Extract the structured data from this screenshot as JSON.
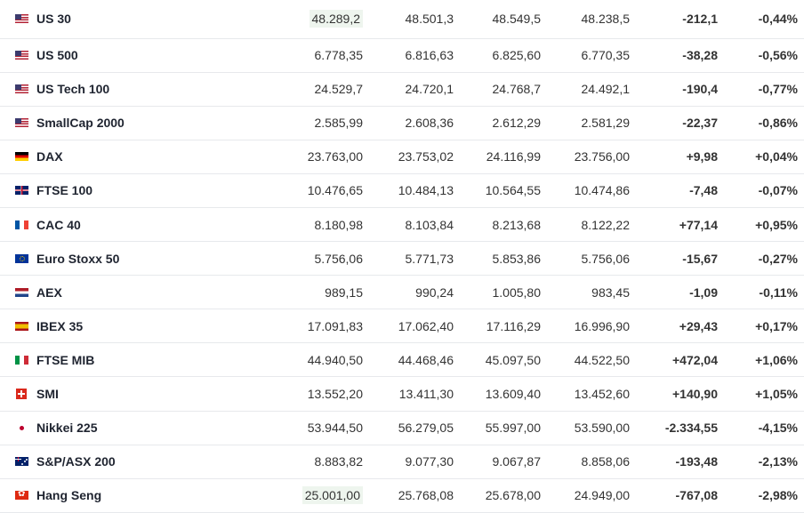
{
  "rows": [
    {
      "name": "US 30",
      "flag": "us-flag-icon",
      "last": "48.289,2",
      "open": "48.501,3",
      "high": "48.549,5",
      "low": "48.238,5",
      "change": "-212,1",
      "change_pct": "-0,44%",
      "dir": "down",
      "highlight": true
    },
    {
      "name": "US 500",
      "flag": "us-flag-icon",
      "last": "6.778,35",
      "open": "6.816,63",
      "high": "6.825,60",
      "low": "6.770,35",
      "change": "-38,28",
      "change_pct": "-0,56%",
      "dir": "down"
    },
    {
      "name": "US Tech 100",
      "flag": "us-flag-icon",
      "last": "24.529,7",
      "open": "24.720,1",
      "high": "24.768,7",
      "low": "24.492,1",
      "change": "-190,4",
      "change_pct": "-0,77%",
      "dir": "down"
    },
    {
      "name": "SmallCap 2000",
      "flag": "us-flag-icon",
      "last": "2.585,99",
      "open": "2.608,36",
      "high": "2.612,29",
      "low": "2.581,29",
      "change": "-22,37",
      "change_pct": "-0,86%",
      "dir": "down"
    },
    {
      "name": "DAX",
      "flag": "de-flag-icon",
      "last": "23.763,00",
      "open": "23.753,02",
      "high": "24.116,99",
      "low": "23.756,00",
      "change": "+9,98",
      "change_pct": "+0,04%",
      "dir": "up"
    },
    {
      "name": "FTSE 100",
      "flag": "gb-flag-icon",
      "last": "10.476,65",
      "open": "10.484,13",
      "high": "10.564,55",
      "low": "10.474,86",
      "change": "-7,48",
      "change_pct": "-0,07%",
      "dir": "down"
    },
    {
      "name": "CAC 40",
      "flag": "fr-flag-icon",
      "last": "8.180,98",
      "open": "8.103,84",
      "high": "8.213,68",
      "low": "8.122,22",
      "change": "+77,14",
      "change_pct": "+0,95%",
      "dir": "up"
    },
    {
      "name": "Euro Stoxx 50",
      "flag": "eu-flag-icon",
      "last": "5.756,06",
      "open": "5.771,73",
      "high": "5.853,86",
      "low": "5.756,06",
      "change": "-15,67",
      "change_pct": "-0,27%",
      "dir": "down"
    },
    {
      "name": "AEX",
      "flag": "nl-flag-icon",
      "last": "989,15",
      "open": "990,24",
      "high": "1.005,80",
      "low": "983,45",
      "change": "-1,09",
      "change_pct": "-0,11%",
      "dir": "down"
    },
    {
      "name": "IBEX 35",
      "flag": "es-flag-icon",
      "last": "17.091,83",
      "open": "17.062,40",
      "high": "17.116,29",
      "low": "16.996,90",
      "change": "+29,43",
      "change_pct": "+0,17%",
      "dir": "up"
    },
    {
      "name": "FTSE MIB",
      "flag": "it-flag-icon",
      "last": "44.940,50",
      "open": "44.468,46",
      "high": "45.097,50",
      "low": "44.522,50",
      "change": "+472,04",
      "change_pct": "+1,06%",
      "dir": "up"
    },
    {
      "name": "SMI",
      "flag": "ch-flag-icon",
      "last": "13.552,20",
      "open": "13.411,30",
      "high": "13.609,40",
      "low": "13.452,60",
      "change": "+140,90",
      "change_pct": "+1,05%",
      "dir": "up"
    },
    {
      "name": "Nikkei 225",
      "flag": "jp-flag-icon",
      "last": "53.944,50",
      "open": "56.279,05",
      "high": "55.997,00",
      "low": "53.590,00",
      "change": "-2.334,55",
      "change_pct": "-4,15%",
      "dir": "down"
    },
    {
      "name": "S&P/ASX 200",
      "flag": "au-flag-icon",
      "last": "8.883,82",
      "open": "9.077,30",
      "high": "9.067,87",
      "low": "8.858,06",
      "change": "-193,48",
      "change_pct": "-2,13%",
      "dir": "down"
    },
    {
      "name": "Hang Seng",
      "flag": "hk-flag-icon",
      "last": "25.001,00",
      "open": "25.768,08",
      "high": "25.678,00",
      "low": "24.949,00",
      "change": "-767,08",
      "change_pct": "-2,98%",
      "dir": "down",
      "highlight": true
    }
  ],
  "colors": {
    "up": "#1f8e3d",
    "down": "#d6262b",
    "highlight": "#eef5ee"
  }
}
